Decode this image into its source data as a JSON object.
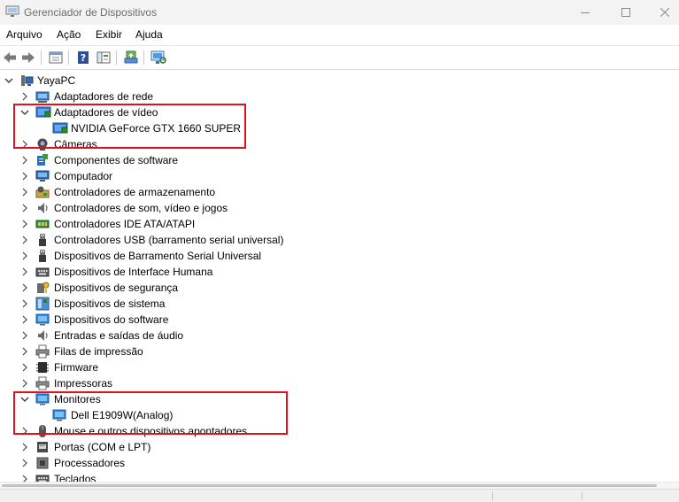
{
  "window": {
    "title": "Gerenciador de Dispositivos"
  },
  "menu": [
    "Arquivo",
    "Ação",
    "Exibir",
    "Ajuda"
  ],
  "toolbar": {
    "buttons": [
      "back-arrow-icon",
      "forward-arrow-icon",
      "properties-icon",
      "help-icon",
      "view-pane-icon",
      "update-driver-icon",
      "scan-hardware-icon"
    ]
  },
  "tree": {
    "root": "YayaPC",
    "rows": [
      {
        "label": "Adaptadores de rede",
        "level": 1,
        "expanded": false,
        "icon": "network-adapter-icon"
      },
      {
        "label": "Adaptadores de vídeo",
        "level": 1,
        "expanded": true,
        "icon": "display-adapter-icon"
      },
      {
        "label": "NVIDIA GeForce GTX 1660 SUPER",
        "level": 2,
        "icon": "display-adapter-icon"
      },
      {
        "label": "Câmeras",
        "level": 1,
        "expanded": false,
        "icon": "camera-icon"
      },
      {
        "label": "Componentes de software",
        "level": 1,
        "expanded": false,
        "icon": "software-component-icon"
      },
      {
        "label": "Computador",
        "level": 1,
        "expanded": false,
        "icon": "computer-icon"
      },
      {
        "label": "Controladores de armazenamento",
        "level": 1,
        "expanded": false,
        "icon": "storage-controller-icon"
      },
      {
        "label": "Controladores de som, vídeo e jogos",
        "level": 1,
        "expanded": false,
        "icon": "speaker-icon"
      },
      {
        "label": "Controladores IDE ATA/ATAPI",
        "level": 1,
        "expanded": false,
        "icon": "ide-controller-icon"
      },
      {
        "label": "Controladores USB (barramento serial universal)",
        "level": 1,
        "expanded": false,
        "icon": "usb-icon"
      },
      {
        "label": "Dispositivos de Barramento Serial Universal",
        "level": 1,
        "expanded": false,
        "icon": "usb-icon"
      },
      {
        "label": "Dispositivos de Interface Humana",
        "level": 1,
        "expanded": false,
        "icon": "keyboard-icon"
      },
      {
        "label": "Dispositivos de segurança",
        "level": 1,
        "expanded": false,
        "icon": "security-key-icon"
      },
      {
        "label": "Dispositivos de sistema",
        "level": 1,
        "expanded": false,
        "icon": "system-device-icon"
      },
      {
        "label": "Dispositivos do software",
        "level": 1,
        "expanded": false,
        "icon": "monitor-icon"
      },
      {
        "label": "Entradas e saídas de áudio",
        "level": 1,
        "expanded": false,
        "icon": "speaker-icon"
      },
      {
        "label": "Filas de impressão",
        "level": 1,
        "expanded": false,
        "icon": "printer-icon"
      },
      {
        "label": "Firmware",
        "level": 1,
        "expanded": false,
        "icon": "chip-icon"
      },
      {
        "label": "Impressoras",
        "level": 1,
        "expanded": false,
        "icon": "printer-icon"
      },
      {
        "label": "Monitores",
        "level": 1,
        "expanded": true,
        "icon": "monitor-icon"
      },
      {
        "label": "Dell E1909W(Analog)",
        "level": 2,
        "icon": "monitor-icon"
      },
      {
        "label": "Mouse e outros dispositivos apontadores",
        "level": 1,
        "expanded": false,
        "icon": "mouse-icon"
      },
      {
        "label": "Portas (COM e LPT)",
        "level": 1,
        "expanded": false,
        "icon": "port-icon"
      },
      {
        "label": "Processadores",
        "level": 1,
        "expanded": false,
        "icon": "processor-icon"
      },
      {
        "label": "Teclados",
        "level": 1,
        "expanded": false,
        "icon": "keyboard-icon"
      }
    ]
  },
  "colors": {
    "highlight": "#e0101d",
    "accent": "#1e90ff"
  }
}
